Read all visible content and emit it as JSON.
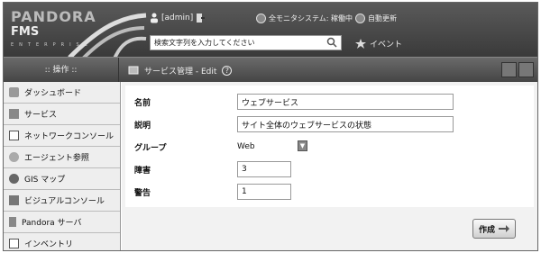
{
  "header": {
    "logo_line1": "PANDORA",
    "logo_line2": "FMS",
    "logo_line3": "ENTERPRISE",
    "user_label": "[admin]",
    "status_text": "全モニタシステム: 稼働中",
    "autorefresh_text": "自動更新",
    "search_placeholder": "検索文字列を入力してください",
    "event_label": "イベント"
  },
  "subbar": {
    "menu_title": ":: 操作 ::",
    "page_title": "サービス管理 - Edit",
    "help_icon": "?"
  },
  "sidebar": {
    "items": [
      {
        "label": "ダッシュボード",
        "icon": "dashboard-icon"
      },
      {
        "label": "サービス",
        "icon": "service-icon"
      },
      {
        "label": "ネットワークコンソール",
        "icon": "network-console-icon"
      },
      {
        "label": "エージェント参照",
        "icon": "agent-icon"
      },
      {
        "label": "GIS マップ",
        "icon": "gis-map-icon"
      },
      {
        "label": "ビジュアルコンソール",
        "icon": "visual-console-icon"
      },
      {
        "label": "Pandora サーバ",
        "icon": "server-icon"
      },
      {
        "label": "インベントリ",
        "icon": "inventory-icon"
      }
    ]
  },
  "form": {
    "name_label": "名前",
    "name_value": "ウェブサービス",
    "description_label": "説明",
    "description_value": "サイト全体のウェブサービスの状態",
    "group_label": "グループ",
    "group_value": "Web",
    "critical_label": "障害",
    "critical_value": "3",
    "warning_label": "警告",
    "warning_value": "1"
  },
  "actions": {
    "create_label": "作成"
  }
}
